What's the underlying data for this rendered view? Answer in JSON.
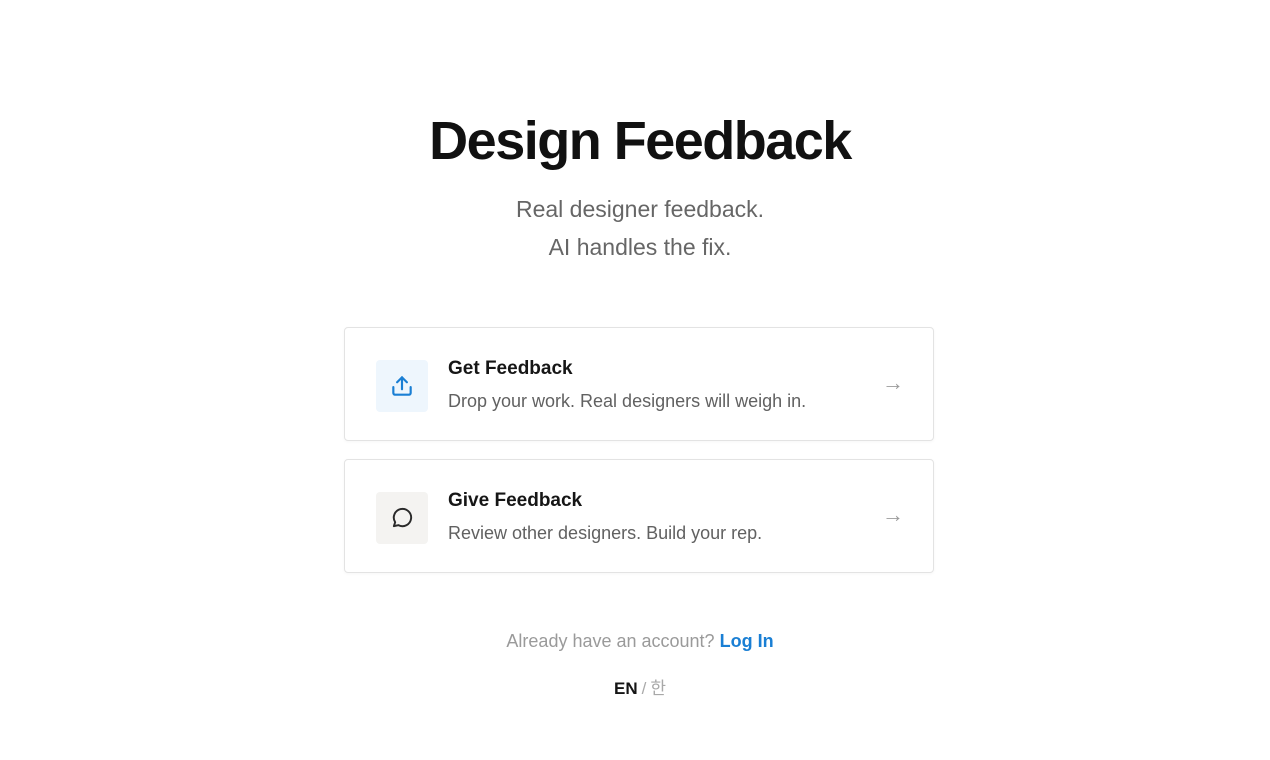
{
  "header": {
    "title": "Design Feedback",
    "subtitle_line1": "Real designer feedback.",
    "subtitle_line2": "AI handles the fix."
  },
  "cards": [
    {
      "title": "Get Feedback",
      "description": "Drop your work. Real designers will weigh in.",
      "icon": "upload-icon",
      "arrow": "→"
    },
    {
      "title": "Give Feedback",
      "description": "Review other designers. Build your rep.",
      "icon": "chat-bubble-icon",
      "arrow": "→"
    }
  ],
  "login": {
    "prompt": "Already have an account?",
    "link": "Log In"
  },
  "language": {
    "active": "EN",
    "separator": "/",
    "alternate": "한"
  },
  "colors": {
    "accent": "#1a7fd4",
    "title": "#111111",
    "muted": "#666666"
  }
}
